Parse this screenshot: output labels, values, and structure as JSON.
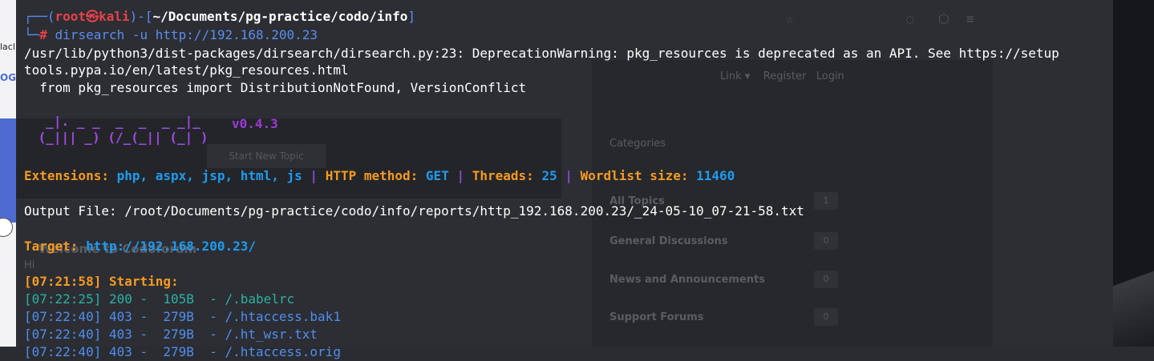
{
  "background": {
    "left_strip_texts": [
      "lacl",
      "OG"
    ],
    "ghost_texts": {
      "links": "Link ▾    Register   Login",
      "categories": "Categories",
      "start_topic": "Start New Topic",
      "all_topics": "All Topics",
      "general": "General Discussions",
      "news": "News and Announcements",
      "support": "Support Forums",
      "welcome": "Welcome to Codoforum",
      "hi": "Hi",
      "counts": [
        "1",
        "0",
        "0",
        "0"
      ]
    }
  },
  "terminal": {
    "prompt": {
      "bracket_open": "┌──(",
      "user": "root㉿kali",
      "bracket_mid": ")-[",
      "path": "~/Documents/pg-practice/codo/info",
      "bracket_close": "]",
      "line2_prefix": "└─",
      "hash": "#",
      "command": " dirsearch -u http://192.168.200.23"
    },
    "warning_line1": "/usr/lib/python3/dist-packages/dirsearch/dirsearch.py:23: DeprecationWarning: pkg_resources is deprecated as an API. See https://setup",
    "warning_line2": "tools.pypa.io/en/latest/pkg_resources.html",
    "warning_line3": "  from pkg_resources import DistributionNotFound, VersionConflict",
    "banner": {
      "ascii_line1": "  _|. _ _  _  _  _ _|_",
      "ascii_line2": " (_||| _) (/_(_|| (_| )",
      "version": "v0.4.3"
    },
    "config": {
      "ext_label": "Extensions: ",
      "ext_value": "php, aspx, jsp, html, js",
      "sep": " | ",
      "method_label": "HTTP method: ",
      "method_value": "GET",
      "threads_label": "Threads: ",
      "threads_value": "25",
      "wordlist_label": "Wordlist size: ",
      "wordlist_value": "11460"
    },
    "output_file": "Output File: /root/Documents/pg-practice/codo/info/reports/http_192.168.200.23/_24-05-10_07-21-58.txt",
    "target_label": "Target: ",
    "target_value": "http://192.168.200.23/",
    "starting": "[07:21:58] Starting:",
    "results": [
      {
        "text": "[07:22:25] 200 -  105B  - /.babelrc",
        "status": "200"
      },
      {
        "text": "[07:22:40] 403 -  279B  - /.htaccess.bak1",
        "status": "403"
      },
      {
        "text": "[07:22:40] 403 -  279B  - /.ht_wsr.txt",
        "status": "403"
      },
      {
        "text": "[07:22:40] 403 -  279B  - /.htaccess.orig",
        "status": "403"
      }
    ]
  },
  "colors": {
    "prompt_blue": "#5c8cf0",
    "prompt_red": "#e8414a",
    "label_orange": "#f59a23",
    "value_cyan": "#1f9bf0",
    "banner_purple": "#a04ae8",
    "ok_teal": "#2bb1a4"
  }
}
